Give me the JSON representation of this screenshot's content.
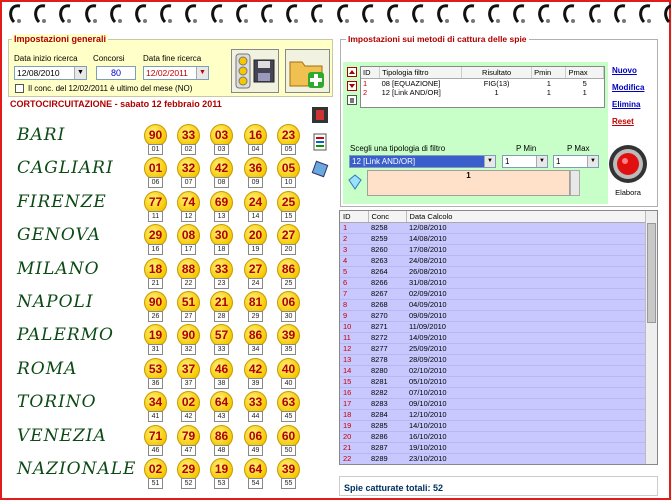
{
  "general": {
    "title": "Impostazioni generali",
    "start_label": "Data inizio ricerca",
    "start_value": "12/08/2010",
    "contests_label": "Concorsi",
    "contests_value": "80",
    "end_label": "Data fine ricerca",
    "end_value": "12/02/2011",
    "checkbox_label": "Il conc. del 12/02/2011 è ultimo del mese (NO)"
  },
  "cc_title": "CORTOCIRCUITAZIONE - sabato 12 febbraio 2011",
  "wheels": [
    {
      "name": "BARI",
      "nums": [
        "90",
        "33",
        "03",
        "16",
        "23"
      ],
      "pos": [
        "01",
        "02",
        "03",
        "04",
        "05"
      ]
    },
    {
      "name": "CAGLIARI",
      "nums": [
        "01",
        "32",
        "42",
        "36",
        "05"
      ],
      "pos": [
        "06",
        "07",
        "08",
        "09",
        "10"
      ]
    },
    {
      "name": "FIRENZE",
      "nums": [
        "77",
        "74",
        "69",
        "24",
        "25"
      ],
      "pos": [
        "11",
        "12",
        "13",
        "14",
        "15"
      ]
    },
    {
      "name": "GENOVA",
      "nums": [
        "29",
        "08",
        "30",
        "20",
        "27"
      ],
      "pos": [
        "16",
        "17",
        "18",
        "19",
        "20"
      ]
    },
    {
      "name": "MILANO",
      "nums": [
        "18",
        "88",
        "33",
        "27",
        "86"
      ],
      "pos": [
        "21",
        "22",
        "23",
        "24",
        "25"
      ]
    },
    {
      "name": "NAPOLI",
      "nums": [
        "90",
        "51",
        "21",
        "81",
        "06"
      ],
      "pos": [
        "26",
        "27",
        "28",
        "29",
        "30"
      ]
    },
    {
      "name": "PALERMO",
      "nums": [
        "19",
        "90",
        "57",
        "86",
        "39"
      ],
      "pos": [
        "31",
        "32",
        "33",
        "34",
        "35"
      ]
    },
    {
      "name": "ROMA",
      "nums": [
        "53",
        "37",
        "46",
        "42",
        "40"
      ],
      "pos": [
        "36",
        "37",
        "38",
        "39",
        "40"
      ]
    },
    {
      "name": "TORINO",
      "nums": [
        "34",
        "02",
        "64",
        "33",
        "63"
      ],
      "pos": [
        "41",
        "42",
        "43",
        "44",
        "45"
      ]
    },
    {
      "name": "VENEZIA",
      "nums": [
        "71",
        "79",
        "86",
        "06",
        "60"
      ],
      "pos": [
        "46",
        "47",
        "48",
        "49",
        "50"
      ]
    },
    {
      "name": "NAZIONALE",
      "nums": [
        "02",
        "29",
        "19",
        "64",
        "39"
      ],
      "pos": [
        "51",
        "52",
        "53",
        "54",
        "55"
      ]
    }
  ],
  "methods": {
    "title": "Impostazioni sui metodi di cattura delle spie",
    "columns": [
      "ID",
      "Tipologia filtro",
      "Risultato",
      "Pmin",
      "Pmax"
    ],
    "rows": [
      [
        "1",
        "08 [EQUAZIONE]",
        "FIG(13)",
        "1",
        "5"
      ],
      [
        "2",
        "12 [Link AND/OR]",
        "1",
        "1",
        "1"
      ]
    ],
    "links": {
      "new": "Nuovo",
      "edit": "Modifica",
      "delete": "Elimina",
      "reset": "Reset"
    },
    "filter_label": "Scegli una tipologia di filtro",
    "filter_value": "12 [Link AND/OR]",
    "pmin_label": "P Min",
    "pmin_value": "1",
    "pmax_label": "P Max",
    "pmax_value": "1",
    "result_value": "1",
    "process_label": "Elabora"
  },
  "calc": {
    "columns": [
      "ID",
      "Conc",
      "Data Calcolo"
    ],
    "rows": [
      [
        "1",
        "8258",
        "12/08/2010"
      ],
      [
        "2",
        "8259",
        "14/08/2010"
      ],
      [
        "3",
        "8260",
        "17/08/2010"
      ],
      [
        "4",
        "8263",
        "24/08/2010"
      ],
      [
        "5",
        "8264",
        "26/08/2010"
      ],
      [
        "6",
        "8266",
        "31/08/2010"
      ],
      [
        "7",
        "8267",
        "02/09/2010"
      ],
      [
        "8",
        "8268",
        "04/09/2010"
      ],
      [
        "9",
        "8270",
        "09/09/2010"
      ],
      [
        "10",
        "8271",
        "11/09/2010"
      ],
      [
        "11",
        "8272",
        "14/09/2010"
      ],
      [
        "12",
        "8277",
        "25/09/2010"
      ],
      [
        "13",
        "8278",
        "28/09/2010"
      ],
      [
        "14",
        "8280",
        "02/10/2010"
      ],
      [
        "15",
        "8281",
        "05/10/2010"
      ],
      [
        "16",
        "8282",
        "07/10/2010"
      ],
      [
        "17",
        "8283",
        "09/10/2010"
      ],
      [
        "18",
        "8284",
        "12/10/2010"
      ],
      [
        "19",
        "8285",
        "14/10/2010"
      ],
      [
        "20",
        "8286",
        "16/10/2010"
      ],
      [
        "21",
        "8287",
        "19/10/2010"
      ],
      [
        "22",
        "8289",
        "23/10/2010"
      ],
      [
        "23",
        "8290",
        "26/10/2010"
      ]
    ],
    "total": "Spie catturate totali: 52"
  }
}
